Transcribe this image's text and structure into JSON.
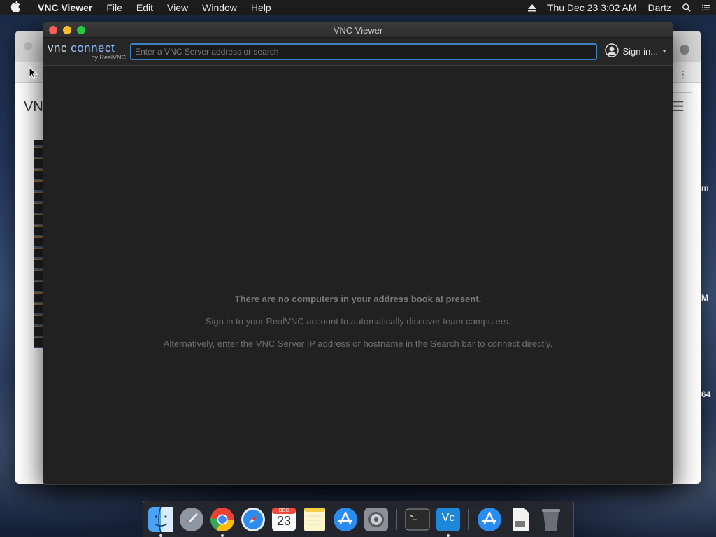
{
  "menubar": {
    "app_name": "VNC Viewer",
    "items": [
      "File",
      "Edit",
      "View",
      "Window",
      "Help"
    ],
    "clock": "Thu Dec 23  3:02 AM",
    "user": "Dartz"
  },
  "background_window": {
    "visible_text": "VN",
    "side_letters": [
      "m",
      "M",
      "64"
    ]
  },
  "vnc_window": {
    "title": "VNC Viewer",
    "logo": {
      "line1_a": "vnc ",
      "line1_b": "connect",
      "line2": "by RealVNC"
    },
    "search": {
      "placeholder": "Enter a VNC Server address or search",
      "value": ""
    },
    "sign_in_label": "Sign in...",
    "messages": {
      "empty_title": "There are no computers in your address book at present.",
      "sign_in_hint": "Sign in to your RealVNC account to automatically discover team computers.",
      "alternative_hint": "Alternatively, enter the VNC Server IP address or hostname in the Search bar to connect directly."
    }
  },
  "dock": {
    "calendar_month": "DEC",
    "calendar_day": "23",
    "terminal_prompt": ">_",
    "vnc_label": "Vc",
    "items": [
      {
        "name": "finder",
        "icon": "finder-icon"
      },
      {
        "name": "launchpad",
        "icon": "rocket-icon"
      },
      {
        "name": "chrome",
        "icon": "chrome-icon"
      },
      {
        "name": "safari",
        "icon": "compass-icon"
      },
      {
        "name": "calendar",
        "icon": "calendar-icon"
      },
      {
        "name": "notes",
        "icon": "notes-icon"
      },
      {
        "name": "app-store",
        "icon": "app-store-icon"
      },
      {
        "name": "system-preferences",
        "icon": "gear-icon"
      },
      {
        "name": "terminal",
        "icon": "terminal-icon"
      },
      {
        "name": "vnc-viewer",
        "icon": "vnc-icon"
      },
      {
        "name": "app-store-downloads",
        "icon": "app-store-icon"
      },
      {
        "name": "disk",
        "icon": "disk-icon"
      },
      {
        "name": "trash",
        "icon": "trash-icon"
      }
    ]
  },
  "colors": {
    "accent": "#3f7fc3",
    "window_bg": "#212121",
    "close": "#fc5f57",
    "minimize": "#fdbc2e",
    "maximize": "#28c840"
  }
}
